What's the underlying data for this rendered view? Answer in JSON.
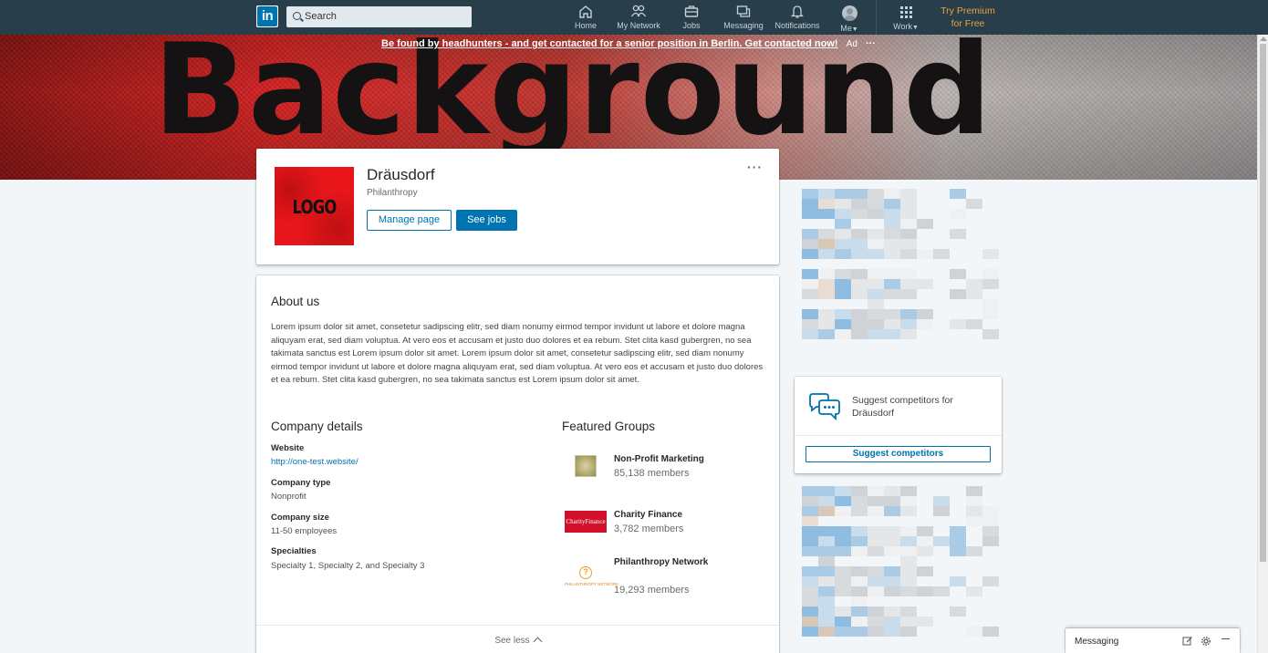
{
  "nav": {
    "logo_text": "in",
    "search_placeholder": "Search",
    "items": [
      {
        "label": "Home",
        "icon": "home-icon"
      },
      {
        "label": "My Network",
        "icon": "network-icon"
      },
      {
        "label": "Jobs",
        "icon": "briefcase-icon"
      },
      {
        "label": "Messaging",
        "icon": "messaging-icon"
      },
      {
        "label": "Notifications",
        "icon": "bell-icon"
      },
      {
        "label": "Me",
        "icon": "avatar-icon"
      },
      {
        "label": "Work",
        "icon": "grid-icon"
      }
    ],
    "premium_line1": "Try Premium",
    "premium_line2": "for Free"
  },
  "ad": {
    "text": "Be found by headhunters - and get contacted for a senior position in Berlin. Get contacted now!",
    "tag": "Ad",
    "more": "···"
  },
  "banner": {
    "word": "Background"
  },
  "company": {
    "logo_text": "LOGO",
    "name": "Dräusdorf",
    "industry": "Philanthropy",
    "manage_label": "Manage page",
    "jobs_label": "See jobs",
    "more": "···"
  },
  "about": {
    "heading": "About us",
    "body": "Lorem ipsum dolor sit amet, consetetur sadipscing elitr, sed diam nonumy eirmod tempor invidunt ut labore et dolore magna aliquyam erat, sed diam voluptua. At vero eos et accusam et justo duo dolores et ea rebum. Stet clita kasd gubergren, no sea takimata sanctus est Lorem ipsum dolor sit amet. Lorem ipsum dolor sit amet, consetetur sadipscing elitr, sed diam nonumy eirmod tempor invidunt ut labore et dolore magna aliquyam erat, sed diam voluptua. At vero eos et accusam et justo duo dolores et ea rebum. Stet clita kasd gubergren, no sea takimata sanctus est Lorem ipsum dolor sit amet."
  },
  "details": {
    "heading": "Company details",
    "website_label": "Website",
    "website_value": "http://one-test.website/",
    "type_label": "Company type",
    "type_value": "Nonprofit",
    "size_label": "Company size",
    "size_value": "11-50 employees",
    "specialties_label": "Specialties",
    "specialties_value": "Specialty 1, Specialty 2, and Specialty 3"
  },
  "groups": {
    "heading": "Featured Groups",
    "items": [
      {
        "name": "Non-Profit Marketing",
        "members": "85,138 members",
        "logo_text": ""
      },
      {
        "name": "Charity Finance",
        "members": "3,782 members",
        "logo_text": "CharityFinance"
      },
      {
        "name": "Philanthropy Network",
        "members": "19,293 members",
        "logo_text": "PHILANTHROPY NETWORK",
        "logo_glyph": "?"
      }
    ]
  },
  "see_less": "See less",
  "suggest": {
    "text": "Suggest competitors for Dräusdorf",
    "button": "Suggest competitors",
    "icon": "chat-bubbles-icon"
  },
  "messaging": {
    "label": "Messaging",
    "compose_icon": "compose-icon",
    "settings_icon": "gear-icon",
    "minimize_icon": "minimize-icon"
  },
  "colors": {
    "nav_bg": "#283e4a",
    "brand_blue": "#0073b1",
    "premium_gold": "#e7a33e",
    "logo_red": "#e8161b"
  }
}
